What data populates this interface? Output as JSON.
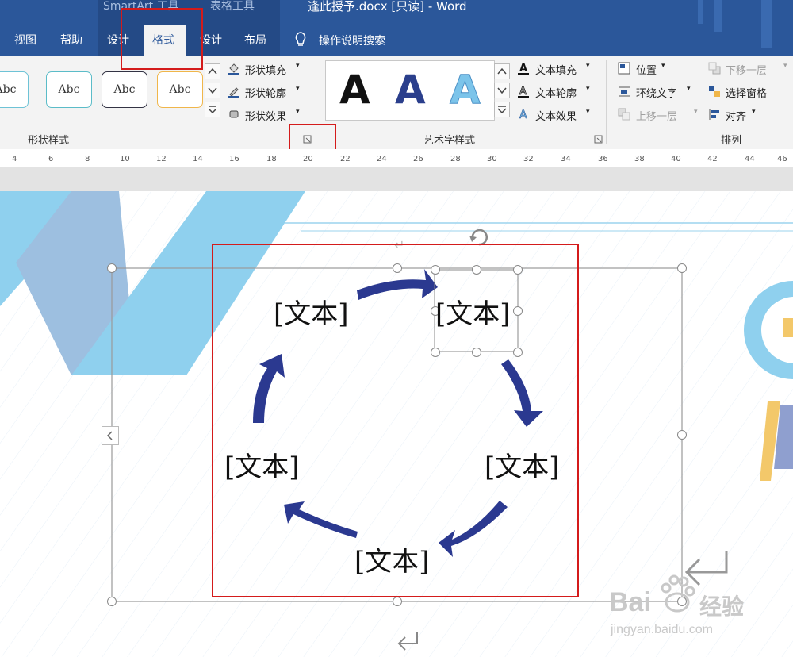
{
  "titlebar": {
    "context_smartart": "SmartArt 工具",
    "context_table": "表格工具",
    "document_title": "逢此授予.docx [只读]  -  Word",
    "tabs": [
      "视图",
      "帮助",
      "设计",
      "格式",
      "设计",
      "布局"
    ],
    "active_tab": "格式",
    "search_hint": "操作说明搜索"
  },
  "ribbon": {
    "shape_styles": {
      "gallery": [
        "Abc",
        "Abc",
        "Abc",
        "Abc"
      ],
      "fill": "形状填充",
      "outline": "形状轮廓",
      "effects": "形状效果",
      "group_label": "形状样式"
    },
    "wordart_styles": {
      "gallery": [
        "A",
        "A",
        "A"
      ],
      "text_fill": "文本填充",
      "text_outline": "文本轮廓",
      "text_effects": "文本效果",
      "group_label": "艺术字样式"
    },
    "arrange": {
      "position": "位置",
      "wrap_text": "环绕文字",
      "bring_forward": "上移一层",
      "send_backward": "下移一层",
      "selection_pane": "选择窗格",
      "align": "对齐",
      "group_label": "排列"
    }
  },
  "ruler": {
    "ticks": [
      "4",
      "6",
      "8",
      "10",
      "12",
      "14",
      "16",
      "18",
      "20",
      "22",
      "24",
      "26",
      "28",
      "30",
      "32",
      "34",
      "36",
      "38",
      "40",
      "42",
      "44",
      "46"
    ]
  },
  "diagram": {
    "nodes": [
      "[文本]",
      "[文本]",
      "[文本]",
      "[文本]",
      "[文本]"
    ]
  },
  "watermark": {
    "brand": "Bai",
    "brand_cn": "经验",
    "url": "jingyan.baidu.com"
  },
  "colors": {
    "title_bar": "#2b579a",
    "arrow": "#2b3990",
    "highlight": "#d41b1b",
    "decor_light": "#8fd0ee",
    "decor_dark": "#9dbfe0"
  }
}
